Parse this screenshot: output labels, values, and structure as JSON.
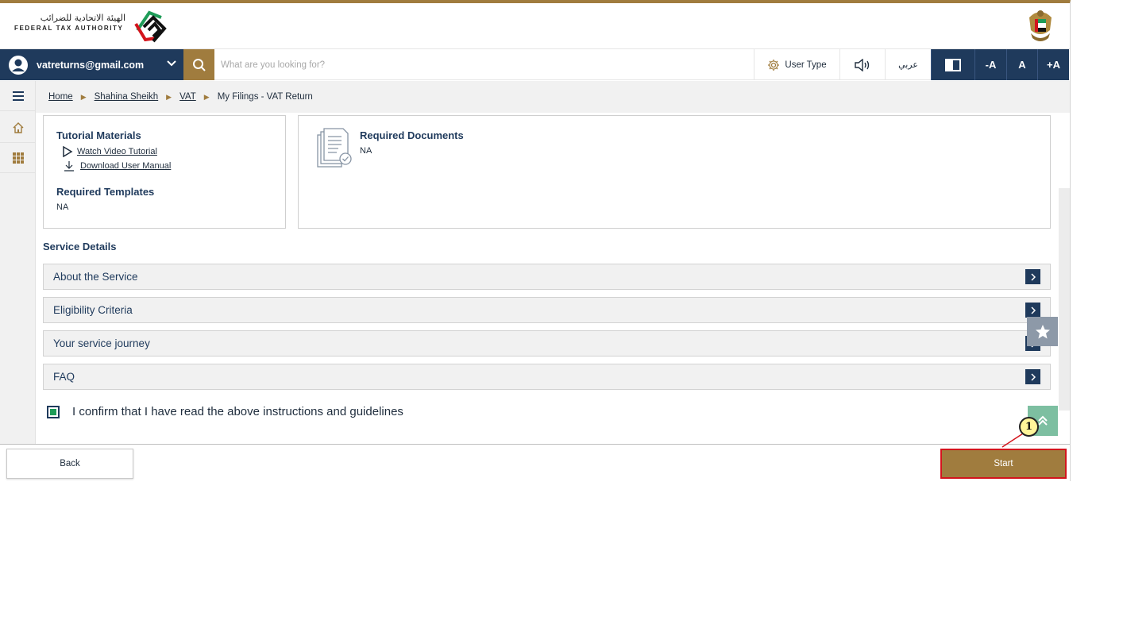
{
  "header": {
    "logo_arabic": "الهيئة الاتحادية للضرائب",
    "logo_english": "FEDERAL TAX AUTHORITY",
    "logo_icon": "fta-logo-icon",
    "emblem_icon": "uae-emblem-icon"
  },
  "navbar": {
    "user_email": "vatreturns@gmail.com",
    "search_placeholder": "What are you looking for?",
    "user_type_label": "User Type",
    "language_label": "عربي",
    "font_decrease": "-A",
    "font_reset": "A",
    "font_increase": "+A"
  },
  "breadcrumb": {
    "items": [
      "Home",
      "Shahina Sheikh",
      "VAT"
    ],
    "current": "My Filings - VAT Return"
  },
  "tutorial": {
    "heading": "Tutorial Materials",
    "video_link": "Watch Video Tutorial",
    "manual_link": "Download User Manual",
    "templates_heading": "Required Templates",
    "templates_value": "NA"
  },
  "documents": {
    "heading": "Required Documents",
    "value": "NA"
  },
  "service_details": {
    "title": "Service Details",
    "sections": [
      "About the Service",
      "Eligibility Criteria",
      "Your service journey",
      "FAQ"
    ]
  },
  "confirmation": {
    "label": "I confirm that I have read the above instructions and guidelines",
    "checked": true
  },
  "footer": {
    "back_label": "Back",
    "start_label": "Start"
  },
  "callout": {
    "number": "1"
  },
  "colors": {
    "navy": "#1f3a5c",
    "gold": "#a07c3e",
    "highlight": "#d3141c",
    "check_green": "#1e9c58"
  }
}
